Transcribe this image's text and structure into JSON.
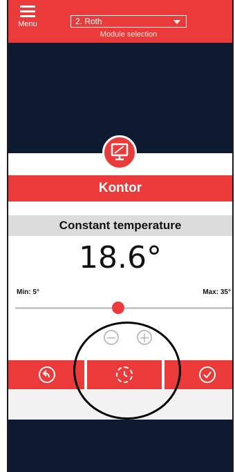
{
  "header": {
    "menu_label": "Menu",
    "module_value": "2. Roth",
    "module_caption": "Module selection"
  },
  "room": {
    "name": "Kontor",
    "icon": "monitor-icon"
  },
  "mode": {
    "label": "Constant temperature"
  },
  "temperature": {
    "value": "18.6°",
    "min_label": "Min: 5°",
    "max_label": "Max: 35°"
  },
  "slider": {
    "min": 5,
    "max": 35,
    "current": 18.6
  },
  "stepper": {
    "minus": "−",
    "plus": "+"
  },
  "actions": [
    {
      "icon": "back-icon"
    },
    {
      "icon": "schedule-clock-icon"
    },
    {
      "icon": "confirm-check-icon"
    }
  ],
  "colors": {
    "accent": "#ea3a3a",
    "dark_bg": "#0d1a30",
    "mode_bar": "#dcdcdc"
  }
}
